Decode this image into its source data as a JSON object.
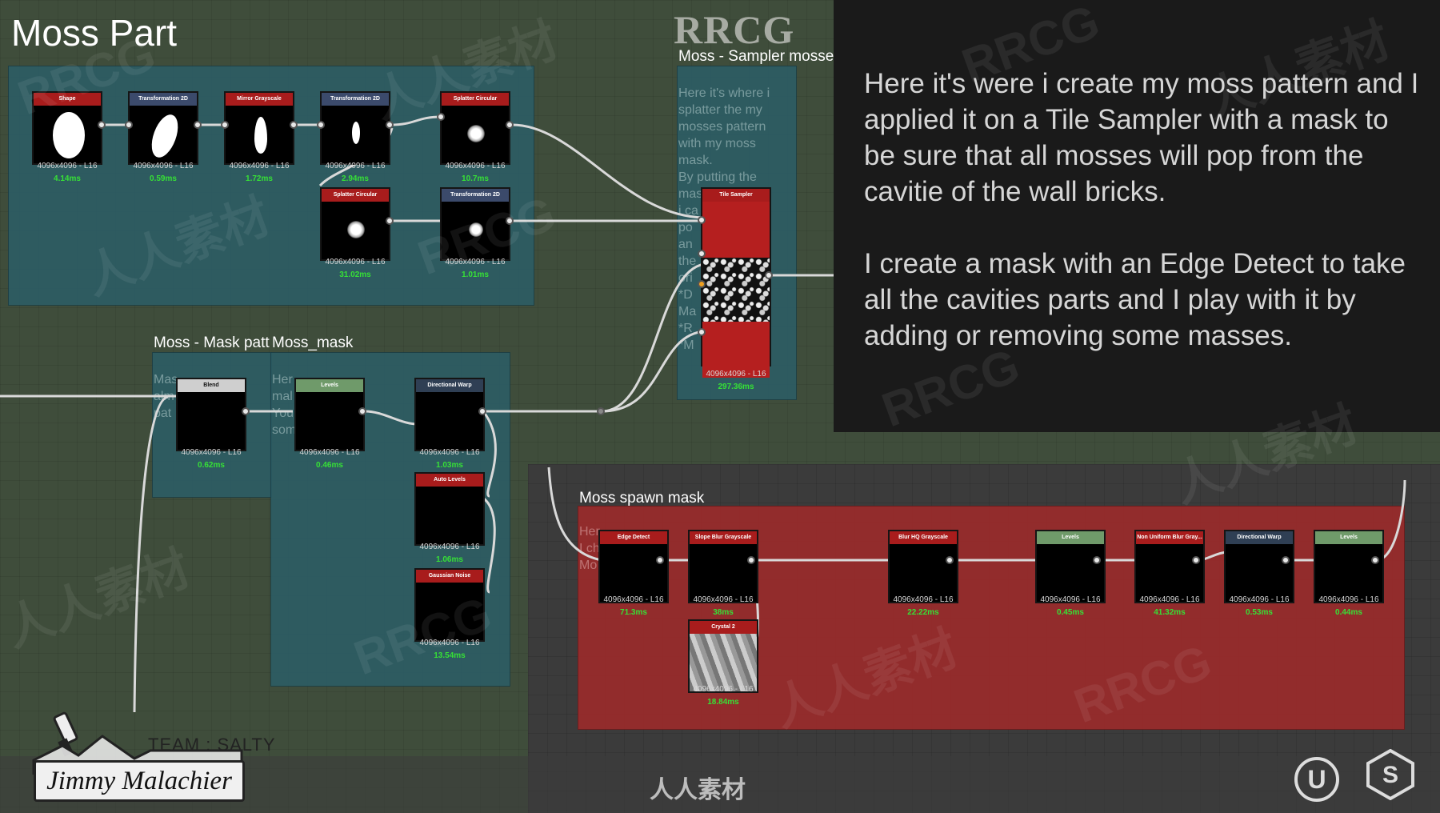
{
  "page_title": "Moss Part",
  "watermark_top": "RRCG",
  "frames": {
    "sampler": {
      "title": "Moss - Sampler mosse",
      "comment": "Here it's where i\nsplatter the my\nmosses pattern\nwith my moss\nmask.\nBy putting the\nmas\ni ca\npo\nan\nthe\nori\n*D\nMa\n*R\n*M"
    },
    "mask_pattern": {
      "title": "Moss - Mask patt",
      "comment": "Mas\nalm\npat"
    },
    "moss_mask": {
      "title": "Moss_mask",
      "comment": "Her\nmal\nYou\nsom"
    },
    "spawn": {
      "title": "Moss spawn mask",
      "comment": "Her\nI ch\nMo"
    }
  },
  "nodes": [
    {
      "id": "shape",
      "label": "Shape",
      "res": "4096x4096 - L16",
      "time": "4.14ms",
      "color": "#a81c1c"
    },
    {
      "id": "transform1",
      "label": "Transformation 2D",
      "res": "4096x4096 - L16",
      "time": "0.59ms",
      "color": "#3b4a6b"
    },
    {
      "id": "mirror",
      "label": "Mirror Grayscale",
      "res": "4096x4096 - L16",
      "time": "1.72ms",
      "color": "#a81c1c"
    },
    {
      "id": "transform2",
      "label": "Transformation 2D",
      "res": "4096x4096 - L16",
      "time": "2.94ms",
      "color": "#3b4a6b"
    },
    {
      "id": "splatter1",
      "label": "Splatter Circular",
      "res": "4096x4096 - L16",
      "time": "10.7ms",
      "color": "#a81c1c"
    },
    {
      "id": "splatter2",
      "label": "Splatter Circular",
      "res": "4096x4096 - L16",
      "time": "31.02ms",
      "color": "#a81c1c"
    },
    {
      "id": "transform3",
      "label": "Transformation 2D",
      "res": "4096x4096 - L16",
      "time": "1.01ms",
      "color": "#3b4a6b"
    },
    {
      "id": "tilesampler",
      "label": "Tile Sampler",
      "res": "4096x4096 - L16",
      "time": "297.36ms",
      "color": "#a81c1c"
    },
    {
      "id": "blend",
      "label": "Blend",
      "res": "4096x4096 - L16",
      "time": "0.62ms",
      "color": "#cfcfcf"
    },
    {
      "id": "levels1",
      "label": "Levels",
      "res": "4096x4096 - L16",
      "time": "0.46ms",
      "color": "#6f9a6a"
    },
    {
      "id": "dirwarp1",
      "label": "Directional Warp",
      "res": "4096x4096 - L16",
      "time": "1.03ms",
      "color": "#2f3f54"
    },
    {
      "id": "autolevels",
      "label": "Auto Levels",
      "res": "4096x4096 - L16",
      "time": "1.06ms",
      "color": "#a81c1c"
    },
    {
      "id": "gaussian",
      "label": "Gaussian Noise",
      "res": "4096x4096 - L16",
      "time": "13.54ms",
      "color": "#a81c1c"
    },
    {
      "id": "edgedetect",
      "label": "Edge Detect",
      "res": "4096x4096 - L16",
      "time": "71.3ms",
      "color": "#a81c1c"
    },
    {
      "id": "slopeblur",
      "label": "Slope Blur Grayscale",
      "res": "4096x4096 - L16",
      "time": "38ms",
      "color": "#a81c1c"
    },
    {
      "id": "crystal",
      "label": "Crystal 2",
      "res": "4096x4096 - L16",
      "time": "18.84ms",
      "color": "#a81c1c"
    },
    {
      "id": "blurhq",
      "label": "Blur HQ Grayscale",
      "res": "4096x4096 - L16",
      "time": "22.22ms",
      "color": "#a81c1c"
    },
    {
      "id": "levels2",
      "label": "Levels",
      "res": "4096x4096 - L16",
      "time": "0.45ms",
      "color": "#6f9a6a"
    },
    {
      "id": "nonuniform",
      "label": "Non Uniform Blur Gray...",
      "res": "4096x4096 - L16",
      "time": "41.32ms",
      "color": "#a81c1c"
    },
    {
      "id": "dirwarp2",
      "label": "Directional Warp",
      "res": "4096x4096 - L16",
      "time": "0.53ms",
      "color": "#2f3f54"
    },
    {
      "id": "levels3",
      "label": "Levels",
      "res": "4096x4096 - L16",
      "time": "0.44ms",
      "color": "#6f9a6a"
    }
  ],
  "description": {
    "p1": "Here it's were i create my moss pattern and I applied it on a Tile Sampler with a mask to be sure that all mosses will pop from the cavitie of the wall bricks.",
    "p2": "I create a mask with an Edge Detect to take all the cavities parts and I play with it by adding or removing some masses."
  },
  "footer": {
    "team": "TEAM : SALTY",
    "author": "Jimmy Malachier",
    "site_text": "人人素材"
  },
  "icons": [
    "unreal-engine-icon",
    "substance-designer-icon",
    "chef-knife-icon"
  ]
}
